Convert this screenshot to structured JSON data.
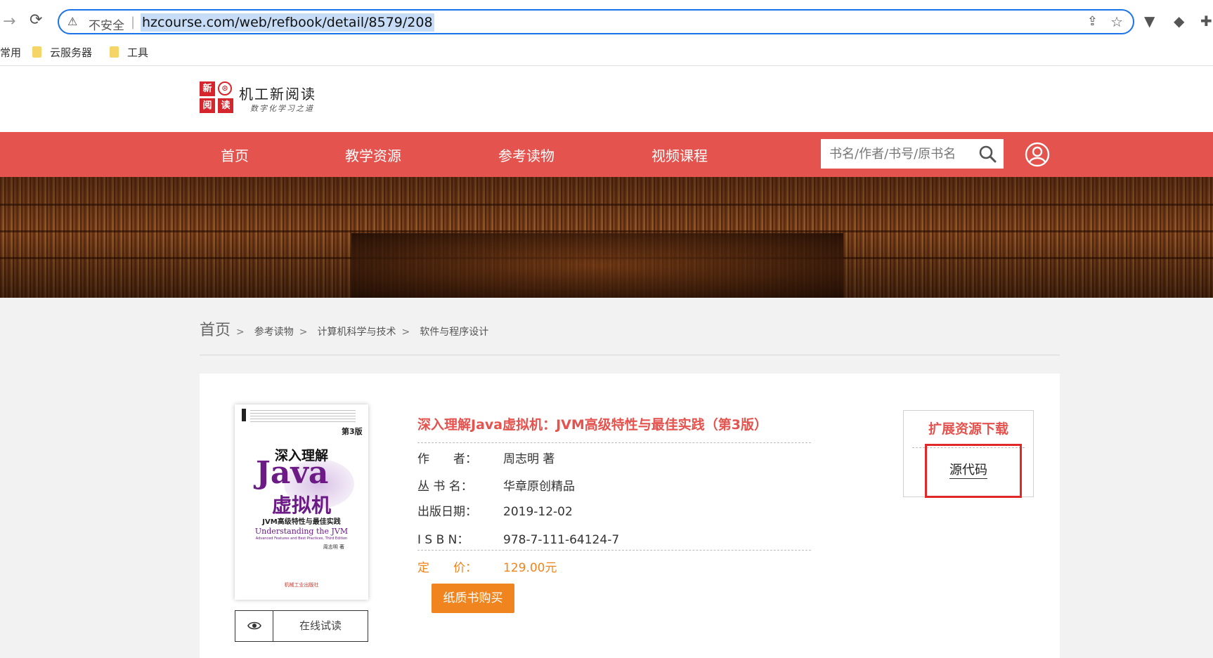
{
  "browser": {
    "security_label": "不安全",
    "url": "hzcourse.com/web/refbook/detail/8579/208",
    "bookmarks": [
      "常用",
      "云服务器",
      "工具"
    ]
  },
  "site": {
    "logo_tiles": [
      "新",
      "阅",
      "读"
    ],
    "logo_name": "机工新阅读",
    "logo_slogan": "数字化学习之道"
  },
  "nav": {
    "items": [
      "首页",
      "教学资源",
      "参考读物",
      "视频课程"
    ],
    "search_placeholder": "书名/作者/书号/原书名"
  },
  "breadcrumb": {
    "home": "首页",
    "items": [
      "参考读物",
      "计算机科学与技术",
      "软件与程序设计"
    ],
    "separator": ">"
  },
  "book": {
    "title": "深入理解Java虚拟机：JVM高级特性与最佳实践（第3版）",
    "fields": [
      {
        "label": "作　　者：",
        "value": "周志明 著"
      },
      {
        "label": "丛 书 名：",
        "value": "华章原创精品"
      },
      {
        "label": "出版日期：",
        "value": "2019-12-02"
      },
      {
        "label": "I S B N：",
        "value": "978-7-111-64124-7"
      }
    ],
    "price_label": "定　　价：",
    "price_value": "129.00元",
    "buy_label": "纸质书购买",
    "try_read_label": "在线试读",
    "cover": {
      "edition": "第3版",
      "title_line1": "深入理解",
      "title_line2": "Java",
      "title_line3": "虚拟机",
      "subtitle": "JVM高级特性与最佳实践",
      "english_title": "Understanding the JVM",
      "english_subtitle": "Advanced Features and Best Practices, Third Edition",
      "author": "周志明 著",
      "publisher": "机械工业出版社"
    }
  },
  "resources": {
    "title": "扩展资源下载",
    "link": "源代码"
  },
  "colors": {
    "brand_red": "#e4534e",
    "price_orange": "#f0841e",
    "highlight_red": "#e02828",
    "address_focus": "#1a73e8"
  }
}
